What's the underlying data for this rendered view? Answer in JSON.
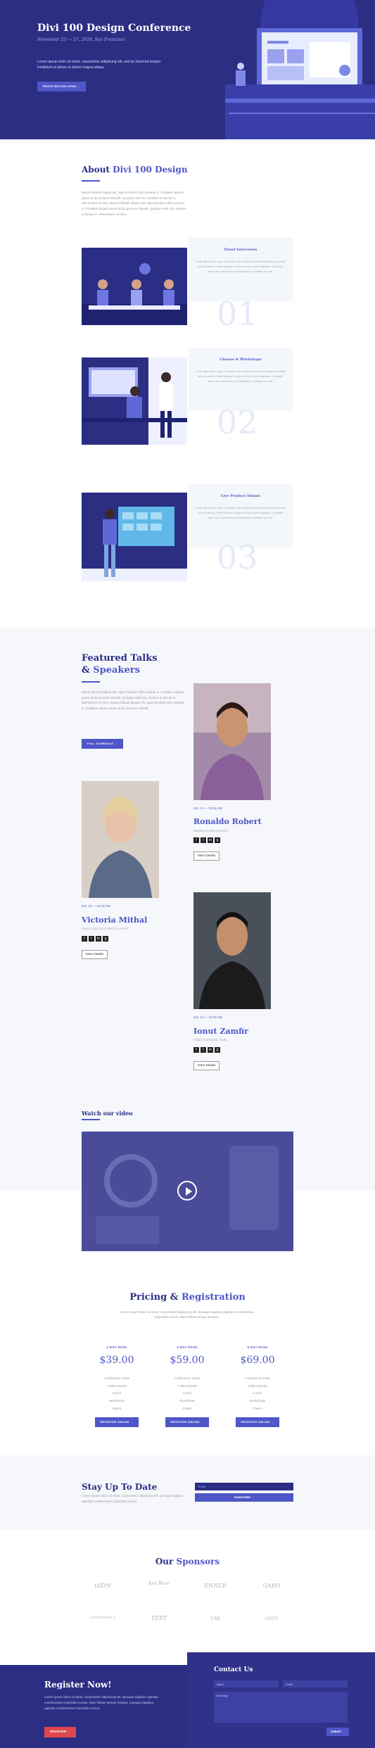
{
  "hero": {
    "title": "Divi 100 Design Conference",
    "date": "November 25 — 27, 2018, San Francisco",
    "description": "Lorem ipsum dolor sit amet, consectetur adipiscing elit, sed do eiusmod tempor incididunt ut labore et dolore magna aliqua.",
    "button": "REGISTRATION OPEN →"
  },
  "about": {
    "title_prefix": "About",
    "title_accent": "Divi 100 Design",
    "text": "Mauris blandit aliquet elit, eget tincidunt nibh pulvinar a. Curabitur aliquet quam id dui posuere blandit. Quisque velit nisi, pretium ut lacinia in, elementum id enim. Mauris blandit aliquet elit, eget tincidunt nibh pulvinar a. Curabitur aliquet quam id dui posuere blandit. Quisque velit nisi, pretium ut lacinia in, elementum id enim."
  },
  "features": [
    {
      "title": "Panel Interviews",
      "text": "Proin eget tortor risus. Curabitur non nulla sit amet nisl tempus convallis quis ac lectus. Pellentesque in ipsum id orci porta dapibus. Curabitur arcu erat, accumsan id imperdiet et, porttitor at sem.",
      "num": "01"
    },
    {
      "title": "Classes & Workshops",
      "text": "Proin eget tortor risus. Curabitur non nulla sit amet nisl tempus convallis quis ac lectus. Pellentesque in ipsum id orci porta dapibus. Curabitur arcu erat, accumsan id imperdiet et, porttitor at sem.",
      "num": "02"
    },
    {
      "title": "Live Product Demos",
      "text": "Proin eget tortor risus. Curabitur non nulla sit amet nisl tempus convallis quis ac lectus. Pellentesque in ipsum id orci porta dapibus. Curabitur arcu erat, accumsan id imperdiet et, porttitor at sem.",
      "num": "03"
    }
  ],
  "speakers": {
    "title_line1": "Featured Talks",
    "title_amp": "&",
    "title_accent": "Speakers",
    "text": "Mauris blandit aliquet elit, eget tincidunt nibh pulvinar a. Curabitur aliquet quam id dui posuere blandit. Quisque velit nisi, pretium ut lacinia in, elementum id enim. Mauris blandit aliquet elit, eget tincidunt nibh pulvinar a. Curabitur aliquet quam id dui posuere blandit.",
    "button": "FULL SCHEDULE →",
    "more": "More Details",
    "list": [
      {
        "date": "Oct. 12 — 10:15 AM",
        "name": "Ronaldo Robert",
        "role": "Building Design Systems",
        "photo_bg": "#8a6a8d"
      },
      {
        "date": "Oct. 13 — 12:15 PM",
        "name": "Victoria Mithal",
        "role": "How to Give your Team's a voice",
        "photo_bg": "#c6b8a6"
      },
      {
        "date": "Oct. 14 — 10:15 AM",
        "name": "Ionut Zamfir",
        "role": "Rapid Prototyping Tools",
        "photo_bg": "#3b3b40"
      }
    ]
  },
  "video": {
    "title": "Watch our video"
  },
  "pricing": {
    "title_prefix": "Pricing &",
    "title_accent": "Registration",
    "subtitle": "Lorem ipsum dolor sit amet, consectetur adipiscing elit. Quisque dapibus egestas condimentum imperdiet cursus. Nam finibus tempor tempus.",
    "plans": [
      {
        "name": "2 DAY PASS",
        "price": "$39.00",
        "features": [
          "Conference Seats",
          "Coffee Breaks",
          "Lunch",
          "Workshops",
          "Flyers"
        ],
        "button": "REGISTER ONLINE →"
      },
      {
        "name": "4 DAY PASS",
        "price": "$59.00",
        "features": [
          "Conference Seats",
          "Coffee Breaks",
          "Lunch",
          "Workshops",
          "Flyers"
        ],
        "button": "REGISTER ONLINE →"
      },
      {
        "name": "6 DAY PASS",
        "price": "$69.00",
        "features": [
          "Conference Seats",
          "Coffee Breaks",
          "Lunch",
          "Workshops",
          "Flyers"
        ],
        "button": "REGISTER ONLINE →"
      }
    ]
  },
  "newsletter": {
    "title": "Stay Up To Date",
    "text": "Lorem ipsum dolor sit amet, consectetur adipiscing elit. Quisque dapibus egestas condimentum imperdiet cursus.",
    "placeholder": "Email",
    "button": "SUBSCRIBE →"
  },
  "sponsors": {
    "title_prefix": "Our",
    "title_accent": "Sponsors",
    "logos": [
      "uitre",
      "Red Wave",
      "ENNER",
      "GABO",
      "CROSSWALLS",
      "TEXT",
      "CAB",
      "LOGO"
    ]
  },
  "register": {
    "title": "Register Now!",
    "text": "Lorem ipsum dolor sit amet, consectetur adipiscing elit. Quisque dapibus egestas condimentum imperdiet cursus. Nam finibus tempor tempus. Quisque dapibus egestas condimentum imperdiet cursus.",
    "button": "REGISTER →"
  },
  "contact": {
    "title": "Contact Us",
    "name_placeholder": "Name",
    "email_placeholder": "Email",
    "message_placeholder": "Message",
    "submit": "SUBMIT →"
  },
  "colors": {
    "primary": "#2b2e83",
    "accent": "#4f56c8",
    "cta": "#e0474c"
  }
}
